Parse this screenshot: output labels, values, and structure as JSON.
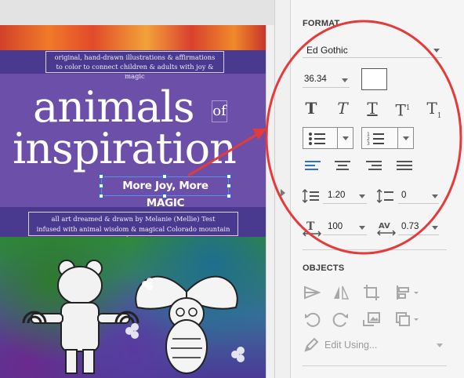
{
  "cover": {
    "tagline_1": "original, hand-drawn illustrations & affirmations",
    "tagline_2": "to color to connect children & adults with joy & magic",
    "title_main": "animals",
    "title_of": "of",
    "title_second": "inspiration",
    "subtitle": "More Joy, More MAGIC",
    "credits_1": "all art dreamed & drawn by Melanie (Mellie) Test",
    "credits_2": "infused with animal wisdom & magical Colorado mountain love"
  },
  "format": {
    "section_title": "FORMAT",
    "font_family": "Ed Gothic",
    "font_size": "36.34",
    "leading": "1.20",
    "space_after": "0",
    "horizontal_scale": "100",
    "tracking": "0.73",
    "fill_color": "#ffffff",
    "buttons": {
      "regular": "T",
      "italic": "T",
      "underline": "T",
      "superscript_base": "T",
      "superscript_mark": "1",
      "subscript_base": "T",
      "subscript_mark": "1"
    }
  },
  "objects": {
    "section_title": "OBJECTS",
    "edit_using": "Edit Using..."
  },
  "colors": {
    "annotation_red": "#e53a3a",
    "selection_blue": "#2d6fd6",
    "align_active": "#2d6fd6"
  }
}
